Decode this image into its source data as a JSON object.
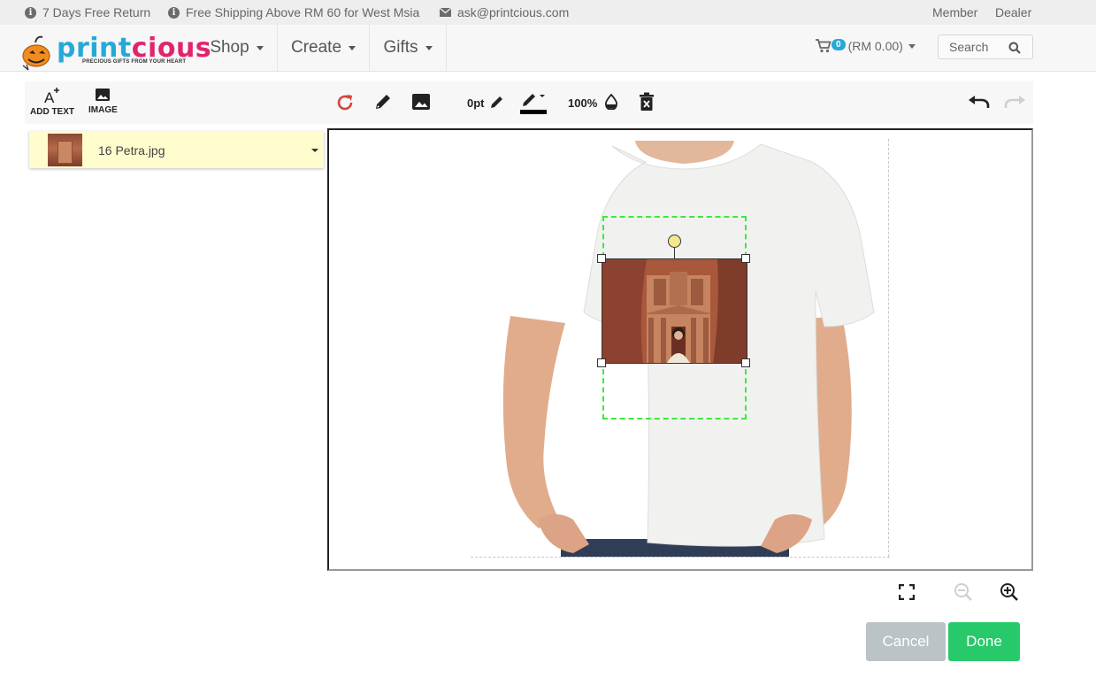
{
  "topbar": {
    "return_text": "7 Days Free Return",
    "shipping_text": "Free Shipping Above RM 60 for West Msia",
    "email_text": "ask@printcious.com",
    "member_link": "Member",
    "dealer_link": "Dealer",
    "icons": [
      "info-icon",
      "info-icon",
      "envelope-icon"
    ]
  },
  "navbar": {
    "logo": {
      "word_part1": "print",
      "word_part2": "cious",
      "tagline": "PRECIOUS GIFTS FROM YOUR HEART"
    },
    "menu": [
      {
        "label": "Shop"
      },
      {
        "label": "Create"
      },
      {
        "label": "Gifts"
      }
    ],
    "cart": {
      "count": "0",
      "total": "(RM 0.00)"
    },
    "search": {
      "label": "Search"
    }
  },
  "toolbar": {
    "add_text_label": "ADD TEXT",
    "image_label": "IMAGE",
    "stroke_width": "0pt",
    "opacity": "100%",
    "icons": [
      "rotate-icon",
      "pencil-icon",
      "image-icon",
      "pen-icon",
      "fill-color-icon",
      "opacity-drop-icon",
      "delete-icon",
      "undo-icon",
      "redo-icon"
    ]
  },
  "layers": [
    {
      "name": "16 Petra.jpg"
    }
  ],
  "colors": {
    "brand_blue": "#27a9d6",
    "brand_pink": "#e2246d",
    "rotate_red": "#d9423a",
    "print_area_green": "#3ee83e",
    "done_green": "#27c96a",
    "cancel_grey": "#bcc3c7"
  },
  "zoom": {
    "icons": [
      "fullscreen-icon",
      "zoom-out-icon",
      "zoom-in-icon"
    ]
  },
  "actions": {
    "cancel_label": "Cancel",
    "done_label": "Done"
  }
}
